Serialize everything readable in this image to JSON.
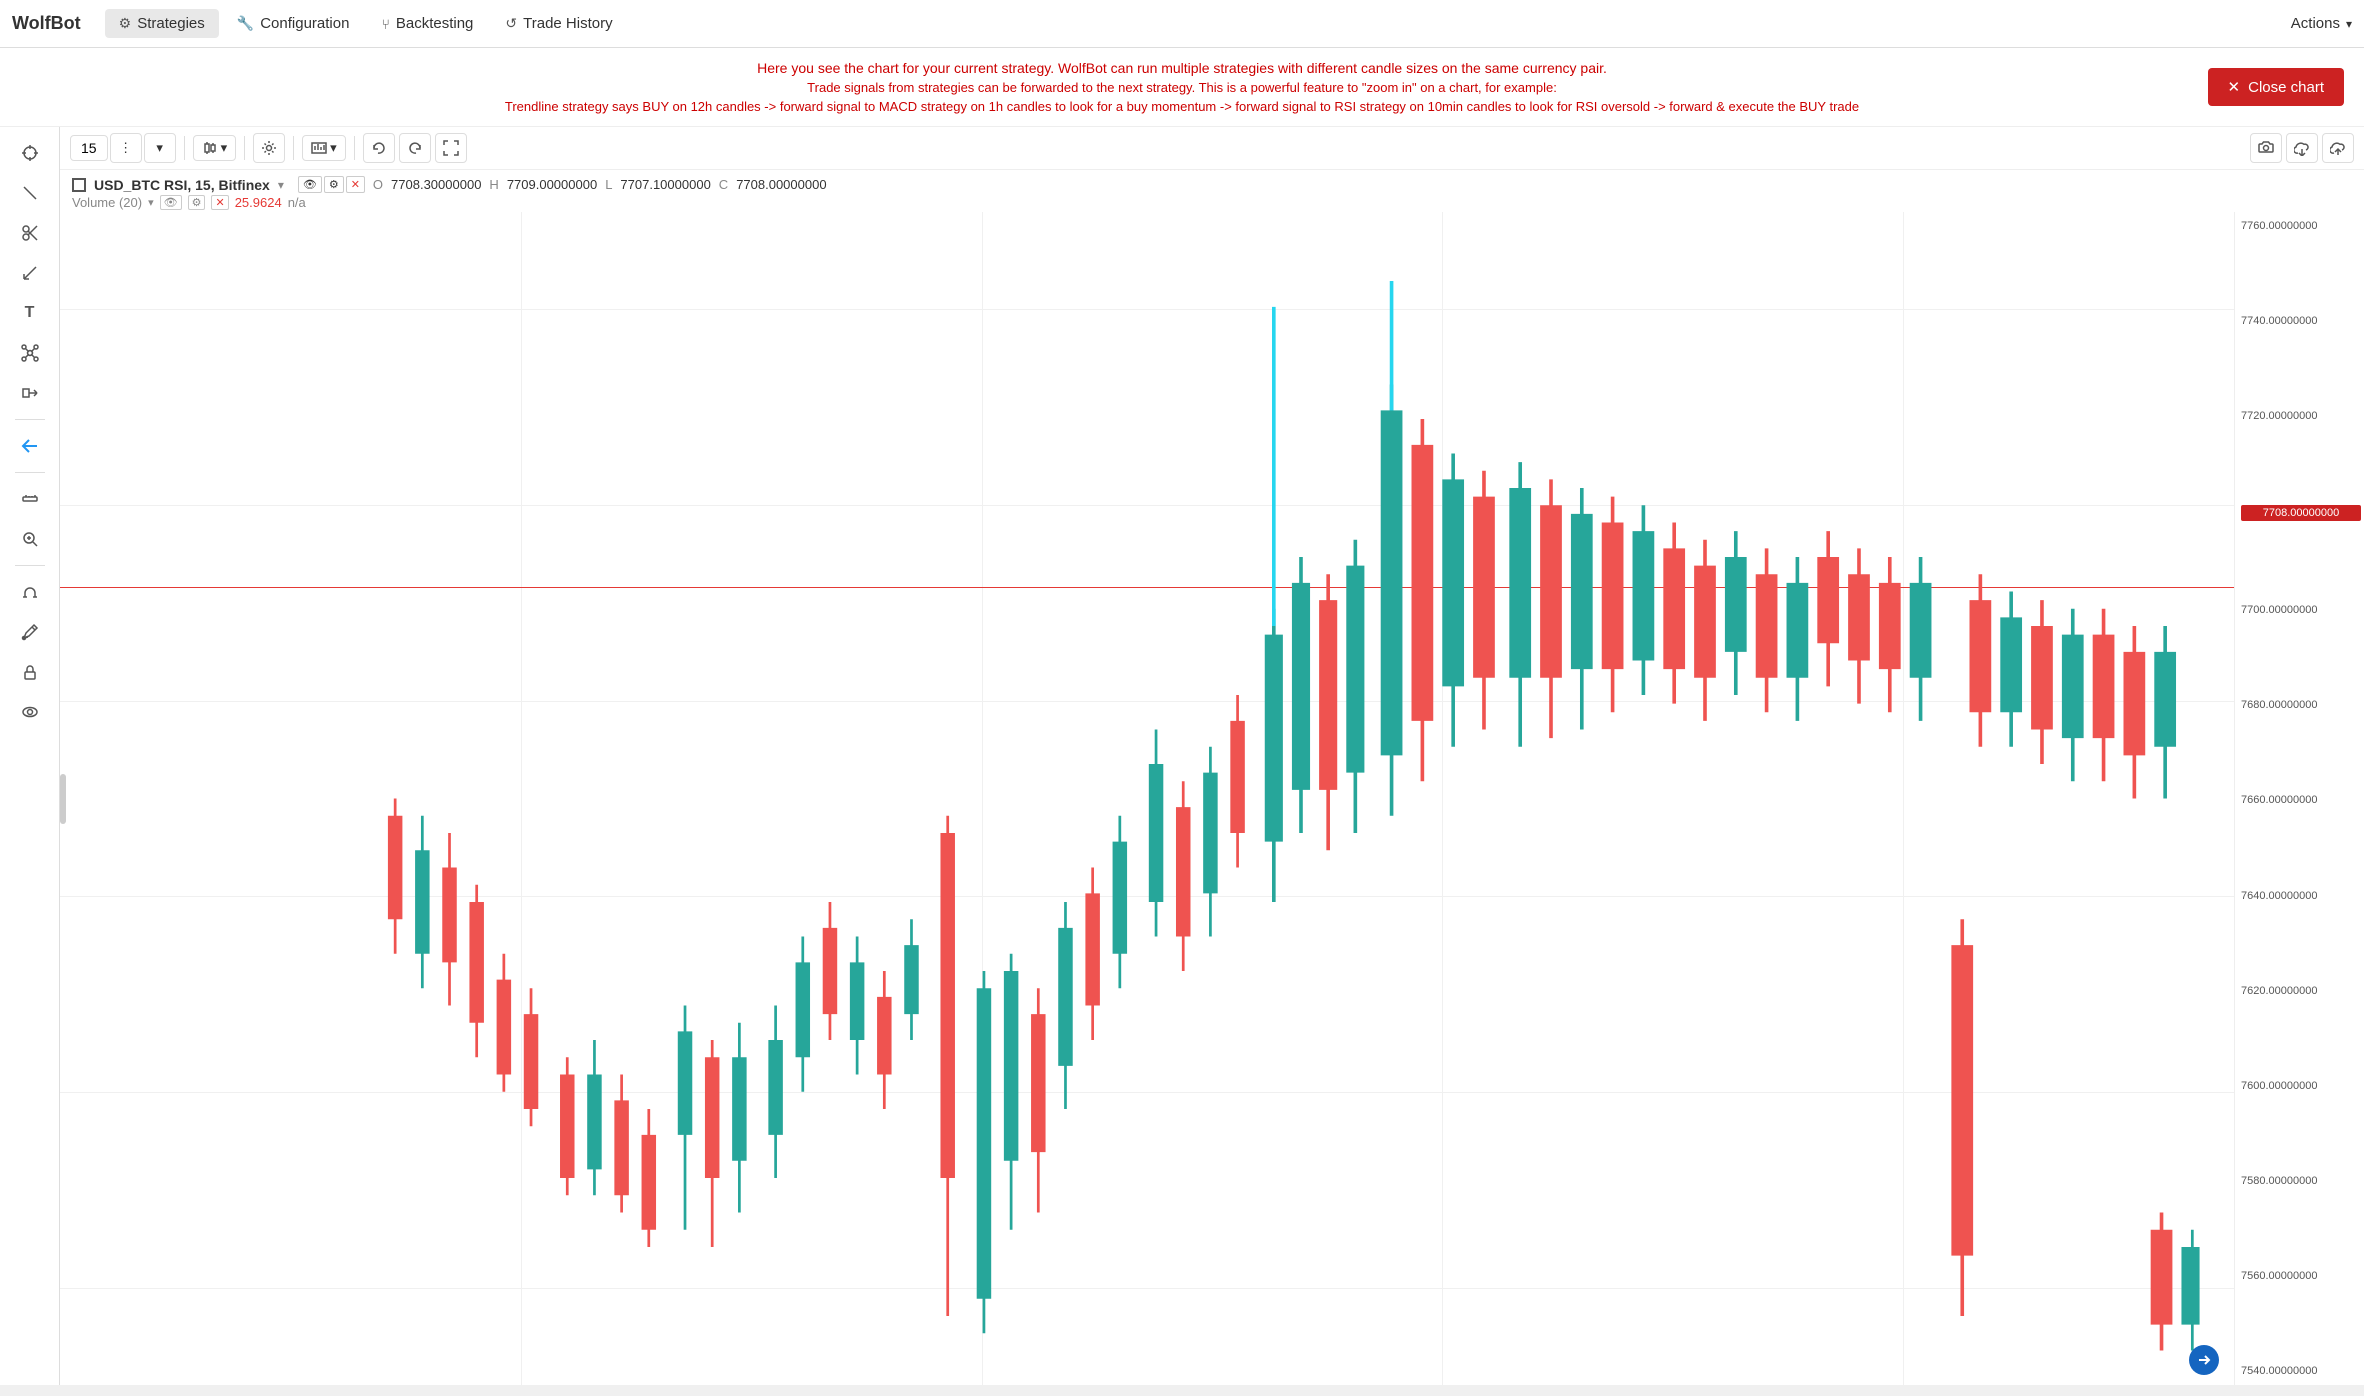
{
  "app": {
    "name": "WolfBot"
  },
  "nav": {
    "items": [
      {
        "id": "strategies",
        "label": "Strategies",
        "icon": "⚙",
        "active": true
      },
      {
        "id": "configuration",
        "label": "Configuration",
        "icon": "🔧",
        "active": false
      },
      {
        "id": "backtesting",
        "label": "Backtesting",
        "icon": "⑂",
        "active": false
      },
      {
        "id": "trade-history",
        "label": "Trade History",
        "icon": "↺",
        "active": false
      }
    ],
    "actions_label": "Actions",
    "actions_chevron": "▾"
  },
  "info_banner": {
    "line1": "Here you see the chart for your current strategy. WolfBot can run multiple strategies with different candle sizes on the same currency pair.",
    "line2": "Trade signals from strategies can be forwarded to the next strategy. This is a powerful feature to \"zoom in\" on a chart, for example:",
    "line3": "Trendline strategy says BUY on 12h candles -> forward signal to MACD strategy on 1h candles to look for a buy momentum -> forward signal to RSI strategy on 10min candles to look for RSI oversold -> forward & execute the BUY trade"
  },
  "close_chart": {
    "label": "Close chart",
    "icon": "✕"
  },
  "chart_toolbar": {
    "interval": "15",
    "dots_btn": "⋮",
    "chevron": "▾",
    "candle_icon": "📊",
    "settings_icon": "⚙",
    "bar_icon": "▦",
    "undo_icon": "←",
    "redo_icon": "→",
    "fullscreen_icon": "⤢",
    "camera_icon": "📷",
    "cloud_download": "⬇",
    "cloud_upload": "⬆"
  },
  "chart_info": {
    "symbol": "USD_BTC RSI, 15, Bitfinex",
    "open_label": "O",
    "open_value": "7708.30000000",
    "high_label": "H",
    "high_value": "7709.00000000",
    "low_label": "L",
    "low_value": "7707.10000000",
    "close_label": "C",
    "close_value": "7708.00000000",
    "volume_label": "Volume (20)",
    "volume_value": "25.9624",
    "volume_na": "n/a"
  },
  "price_scale": {
    "values": [
      "7760.00000000",
      "7740.00000000",
      "7720.00000000",
      "7700.00000000",
      "7680.00000000",
      "7660.00000000",
      "7640.00000000",
      "7620.00000000",
      "7600.00000000",
      "7580.00000000",
      "7560.00000000",
      "7540.00000000"
    ],
    "current_price": "7708.00000000"
  },
  "sidebar_icons": [
    {
      "id": "crosshair",
      "symbol": "⊕",
      "active": false
    },
    {
      "id": "cursor",
      "symbol": "╱",
      "active": false
    },
    {
      "id": "scissors",
      "symbol": "✂",
      "active": false
    },
    {
      "id": "measure",
      "symbol": "╱",
      "active": false
    },
    {
      "id": "text",
      "symbol": "T",
      "active": false
    },
    {
      "id": "node",
      "symbol": "⊛",
      "active": false
    },
    {
      "id": "projections",
      "symbol": "⊞",
      "active": false
    },
    {
      "id": "back-arrow",
      "symbol": "←",
      "active": true
    },
    {
      "id": "ruler",
      "symbol": "📐",
      "active": false
    },
    {
      "id": "zoom-in",
      "symbol": "⊕",
      "active": false
    },
    {
      "id": "magnet",
      "symbol": "🧲",
      "active": false
    },
    {
      "id": "annotate",
      "symbol": "✏",
      "active": false
    },
    {
      "id": "lock-closed",
      "symbol": "🔒",
      "active": false
    },
    {
      "id": "eye",
      "symbol": "👁",
      "active": false
    }
  ],
  "colors": {
    "accent_red": "#cc2222",
    "candle_green": "#26a69a",
    "candle_red": "#ef5350",
    "nav_active_bg": "#e8e8e8",
    "grid_line": "#f0f0f0",
    "price_highlight_bg": "#cc2222"
  }
}
